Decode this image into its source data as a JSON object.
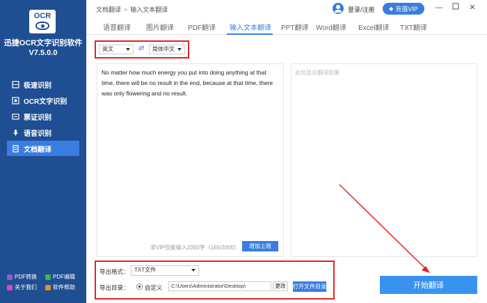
{
  "sidebar": {
    "logo_text": "OCR",
    "app_name": "迅捷OCR文字识别软件",
    "version": "V7.5.0.0",
    "items": [
      {
        "label": "极速识别",
        "icon": "scan-icon"
      },
      {
        "label": "OCR文字识别",
        "icon": "ocr-icon"
      },
      {
        "label": "票证识别",
        "icon": "ticket-icon"
      },
      {
        "label": "语音识别",
        "icon": "mic-icon"
      },
      {
        "label": "文档翻译",
        "icon": "document-translate-icon"
      }
    ],
    "active_index": 4,
    "footer": [
      {
        "label": "PDF转换",
        "icon": "pdf-convert-icon",
        "color": "#8e5cd9"
      },
      {
        "label": "PDF编辑",
        "icon": "pdf-edit-icon",
        "color": "#3fb54a"
      },
      {
        "label": "关于我们",
        "icon": "about-icon",
        "color": "#d94ab8"
      },
      {
        "label": "软件帮助",
        "icon": "help-icon",
        "color": "#f08a24"
      }
    ]
  },
  "header": {
    "breadcrumb": [
      "文档翻译",
      "输入文本翻译"
    ],
    "login_label": "登录/注册",
    "vip_label": "充值VIP",
    "window_controls": [
      "minimize",
      "restore",
      "close"
    ]
  },
  "tabs": [
    "语音翻译",
    "图片翻译",
    "PDF翻译",
    "输入文本翻译",
    "PPT翻译",
    "Word翻译",
    "Excel翻译",
    "TXT翻译"
  ],
  "active_tab": 3,
  "language": {
    "source": "英文",
    "target": "简体中文"
  },
  "input_text": "No matter how much energy you put into doing anything at that time, there will be no result in the end, because at that time, there was only flowering and no result.",
  "result_placeholder": "此处显示翻译结果",
  "counter_text": "非VIP仅能输入2000字（165/2000）",
  "up_limit_label": "增加上限",
  "export": {
    "format_label": "导出格式：",
    "format_value": "TXT文件",
    "dir_label": "导出目录：",
    "custom_label": "自定义",
    "path": "C:\\Users\\Administrator\\Desktop\\",
    "change_label": "更改",
    "open_dir_label": "打开文件目录"
  },
  "start_label": "开始翻译",
  "accent_color": "#3a7de0",
  "highlight_color": "#e02424"
}
